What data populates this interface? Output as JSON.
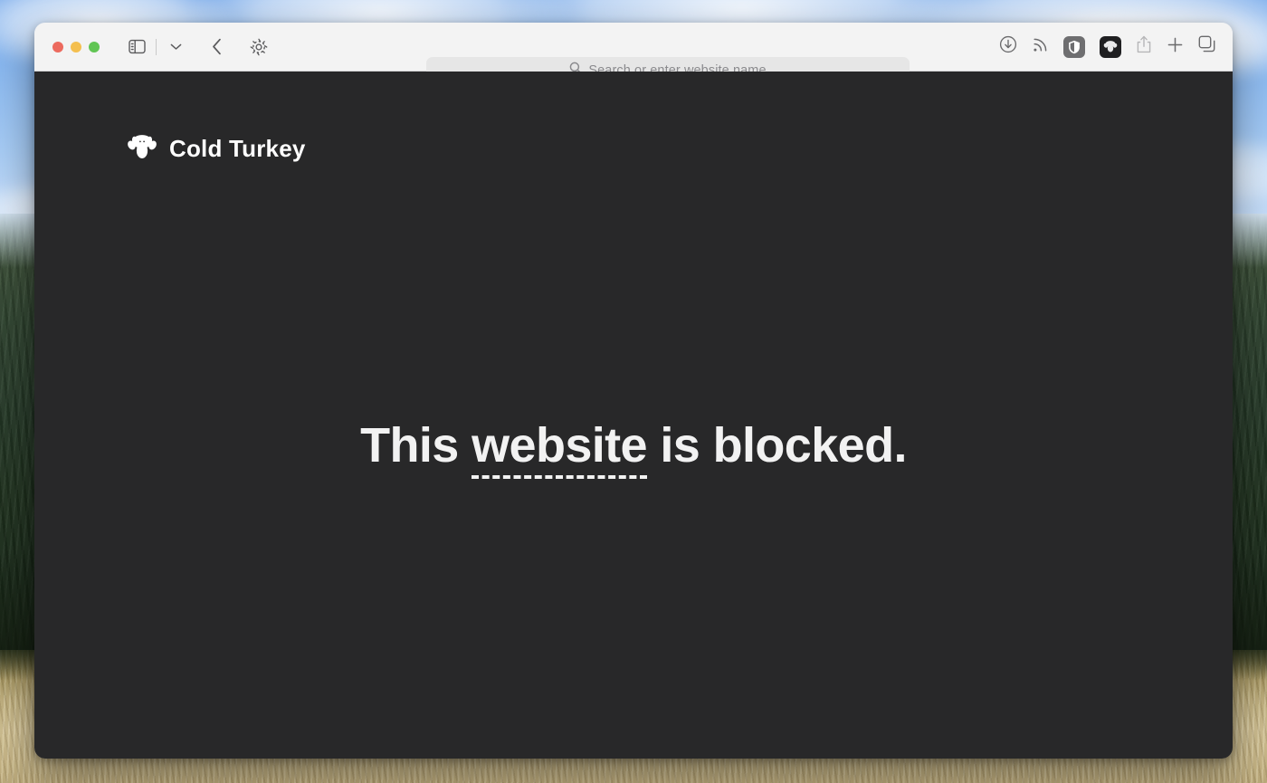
{
  "window": {
    "traffic_lights": [
      {
        "name": "close",
        "color": "#ec6a5e"
      },
      {
        "name": "minimize",
        "color": "#f4bf4f"
      },
      {
        "name": "zoom",
        "color": "#61c554"
      }
    ]
  },
  "toolbar": {
    "left_controls": [
      {
        "icon": "sidebar-icon",
        "label": "Show Sidebar"
      },
      {
        "icon": "chevron-down-icon",
        "label": "Sidebar Options"
      },
      {
        "icon": "back-chevron-icon",
        "label": "Back"
      },
      {
        "icon": "gear-icon",
        "label": "Page Settings"
      }
    ],
    "right_controls": [
      {
        "icon": "download-icon",
        "label": "Downloads"
      },
      {
        "icon": "rss-icon",
        "label": "RSS Feed"
      },
      {
        "icon": "shield-icon",
        "label": "uBlock Origin"
      },
      {
        "icon": "cold-turkey-icon",
        "label": "Cold Turkey Blocker"
      },
      {
        "icon": "share-icon",
        "label": "Share"
      },
      {
        "icon": "plus-icon",
        "label": "New Tab"
      },
      {
        "icon": "tab-overview-icon",
        "label": "Tab Overview"
      }
    ]
  },
  "search": {
    "value": "",
    "placeholder": "Search or enter website name",
    "icon": "search-icon"
  },
  "page": {
    "background_color": "#282829",
    "brand": {
      "logo_icon": "cold-turkey-logo",
      "name": "Cold Turkey"
    },
    "message": {
      "prefix": "This ",
      "emphasis": "website",
      "suffix": " is blocked.",
      "text_color": "#f2f2f2"
    }
  }
}
